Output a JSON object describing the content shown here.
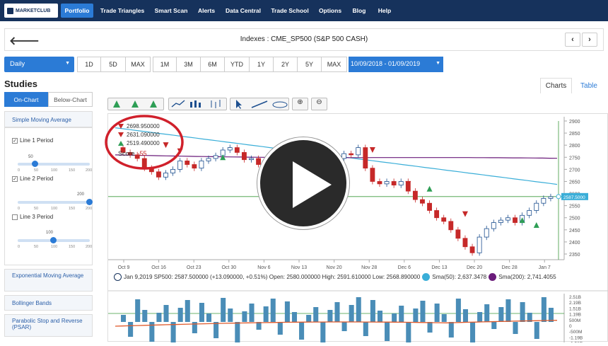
{
  "nav": {
    "logo": "MARKETCLUB",
    "items": [
      "Portfolio",
      "Trade Triangles",
      "Smart Scan",
      "Alerts",
      "Data Central",
      "Trade School",
      "Options",
      "Blog",
      "Help"
    ]
  },
  "header": {
    "title": "Indexes : CME_SP500 (S&P 500 CASH)",
    "back": "🡐",
    "prev": "‹",
    "next": "›"
  },
  "range": {
    "period": "Daily",
    "buttons1": [
      "1D",
      "5D",
      "MAX"
    ],
    "buttons2": [
      "1M",
      "3M",
      "6M",
      "YTD",
      "1Y",
      "2Y",
      "5Y",
      "MAX"
    ],
    "date_range": "10/09/2018 - 01/09/2019"
  },
  "studies": {
    "title": "Studies",
    "tabs": [
      "On-Chart",
      "Below-Chart"
    ],
    "sma_title": "Simple Moving Average",
    "lines": [
      {
        "label": "Line 1 Period",
        "checked": true,
        "value": "50"
      },
      {
        "label": "Line 2 Period",
        "checked": true,
        "value": "200"
      },
      {
        "label": "Line 3 Period",
        "checked": false,
        "value": "100"
      }
    ],
    "ticks": [
      "0",
      "50",
      "100",
      "150",
      "200"
    ],
    "other": [
      "Exponential Moving Average",
      "Bollinger Bands",
      "Parabolic Stop and Reverse (PSAR)"
    ]
  },
  "view_tabs": [
    "Charts",
    "Table"
  ],
  "info": {
    "v1": "2698.950000",
    "v2": "2631.090000",
    "v3": "2519.490000",
    "score_label": "Score",
    "score": "-55"
  },
  "legend": {
    "main": "Jan 9,2019 SP500: 2587.500000 (+13.090000, +0.51%) Open: 2580.000000 High: 2591.610000 Low: 2568.890000",
    "sma50": "Sma(50): 2,637.3478",
    "sma200": "Sma(200): 2,741.4055"
  },
  "chart_data": {
    "type": "candlestick",
    "x_ticks": [
      "Oct 9",
      "Oct 16",
      "Oct 23",
      "Oct 30",
      "Nov 6",
      "Nov 13",
      "Nov 20",
      "Nov 28",
      "Dec 6",
      "Dec 13",
      "Dec 20",
      "Dec 28",
      "Jan 7"
    ],
    "y_ticks": [
      "2900",
      "2850",
      "2800",
      "2750",
      "2700",
      "2650",
      "2600",
      "2550",
      "2500",
      "2450",
      "2400",
      "2350"
    ],
    "ylim": [
      2350,
      2900
    ],
    "last_price_label": "2587.5000",
    "volume_y_ticks": [
      "2.51B",
      "2.19B",
      "1.51B",
      "1.19B",
      "500M",
      "0",
      "-500M",
      "-1.19B",
      "-1.51B"
    ],
    "colors": {
      "up": "#1d4f8f",
      "down": "#c62828",
      "sma50": "#3aaed8",
      "sma200": "#6a1b7a",
      "macd": "#e05a2b",
      "bar": "#4a8db7",
      "buy": "#2e9e55",
      "sell": "#c62828"
    }
  }
}
